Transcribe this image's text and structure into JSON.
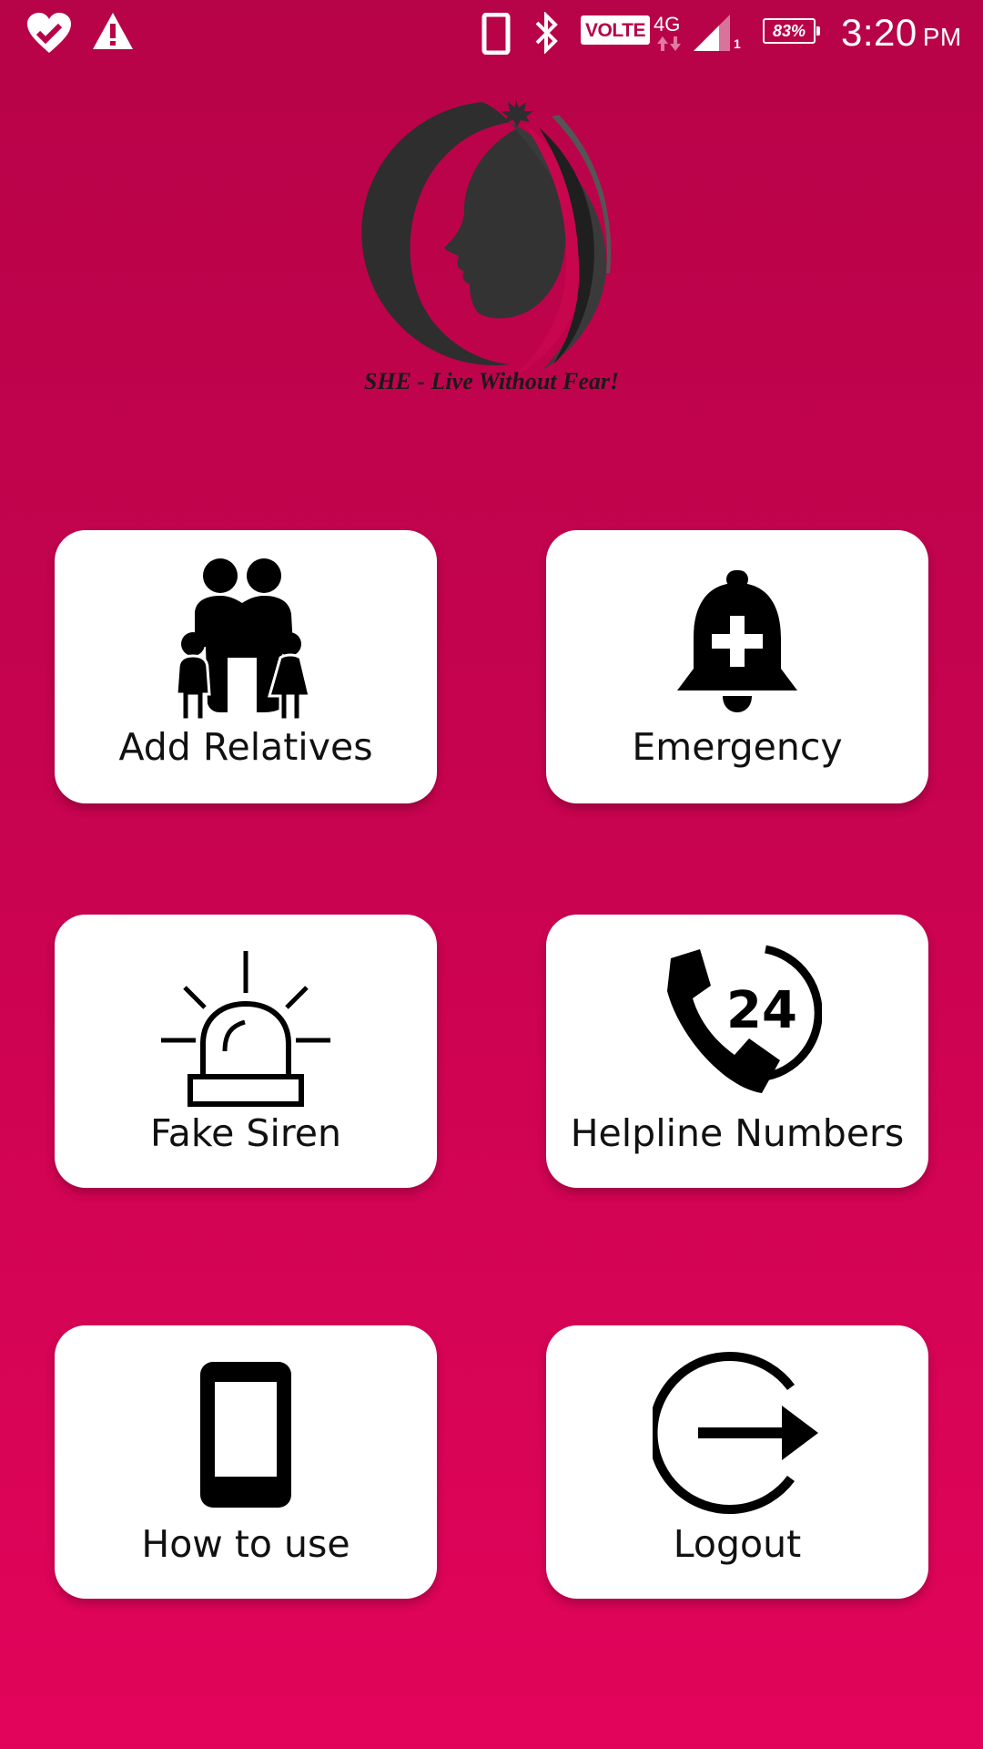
{
  "status_bar": {
    "icons": [
      "heart-check-icon",
      "warning-icon",
      "phone-device-icon",
      "bluetooth-icon",
      "signal-icon",
      "battery-icon"
    ],
    "volte": "VOLTE",
    "network": "4G",
    "sim_slot": "1",
    "battery": "83%",
    "battery_level": 0.83,
    "time": "3:20",
    "ampm": "PM"
  },
  "logo": {
    "icon": "woman-silhouette-logo",
    "tagline": "SHE - Live Without Fear!"
  },
  "menu": {
    "items": [
      {
        "label": "Add Relatives",
        "icon": "family-icon"
      },
      {
        "label": "Emergency",
        "icon": "emergency-bell-icon"
      },
      {
        "label": "Fake Siren",
        "icon": "siren-icon"
      },
      {
        "label": "Helpline Numbers",
        "icon": "helpline-24-icon"
      },
      {
        "label": "How to use",
        "icon": "mobile-phone-icon"
      },
      {
        "label": "Logout",
        "icon": "logout-icon"
      }
    ]
  },
  "colors": {
    "background_top": "#b70348",
    "background_bottom": "#e2045a",
    "tile": "#ffffff",
    "icon": "#000000"
  }
}
